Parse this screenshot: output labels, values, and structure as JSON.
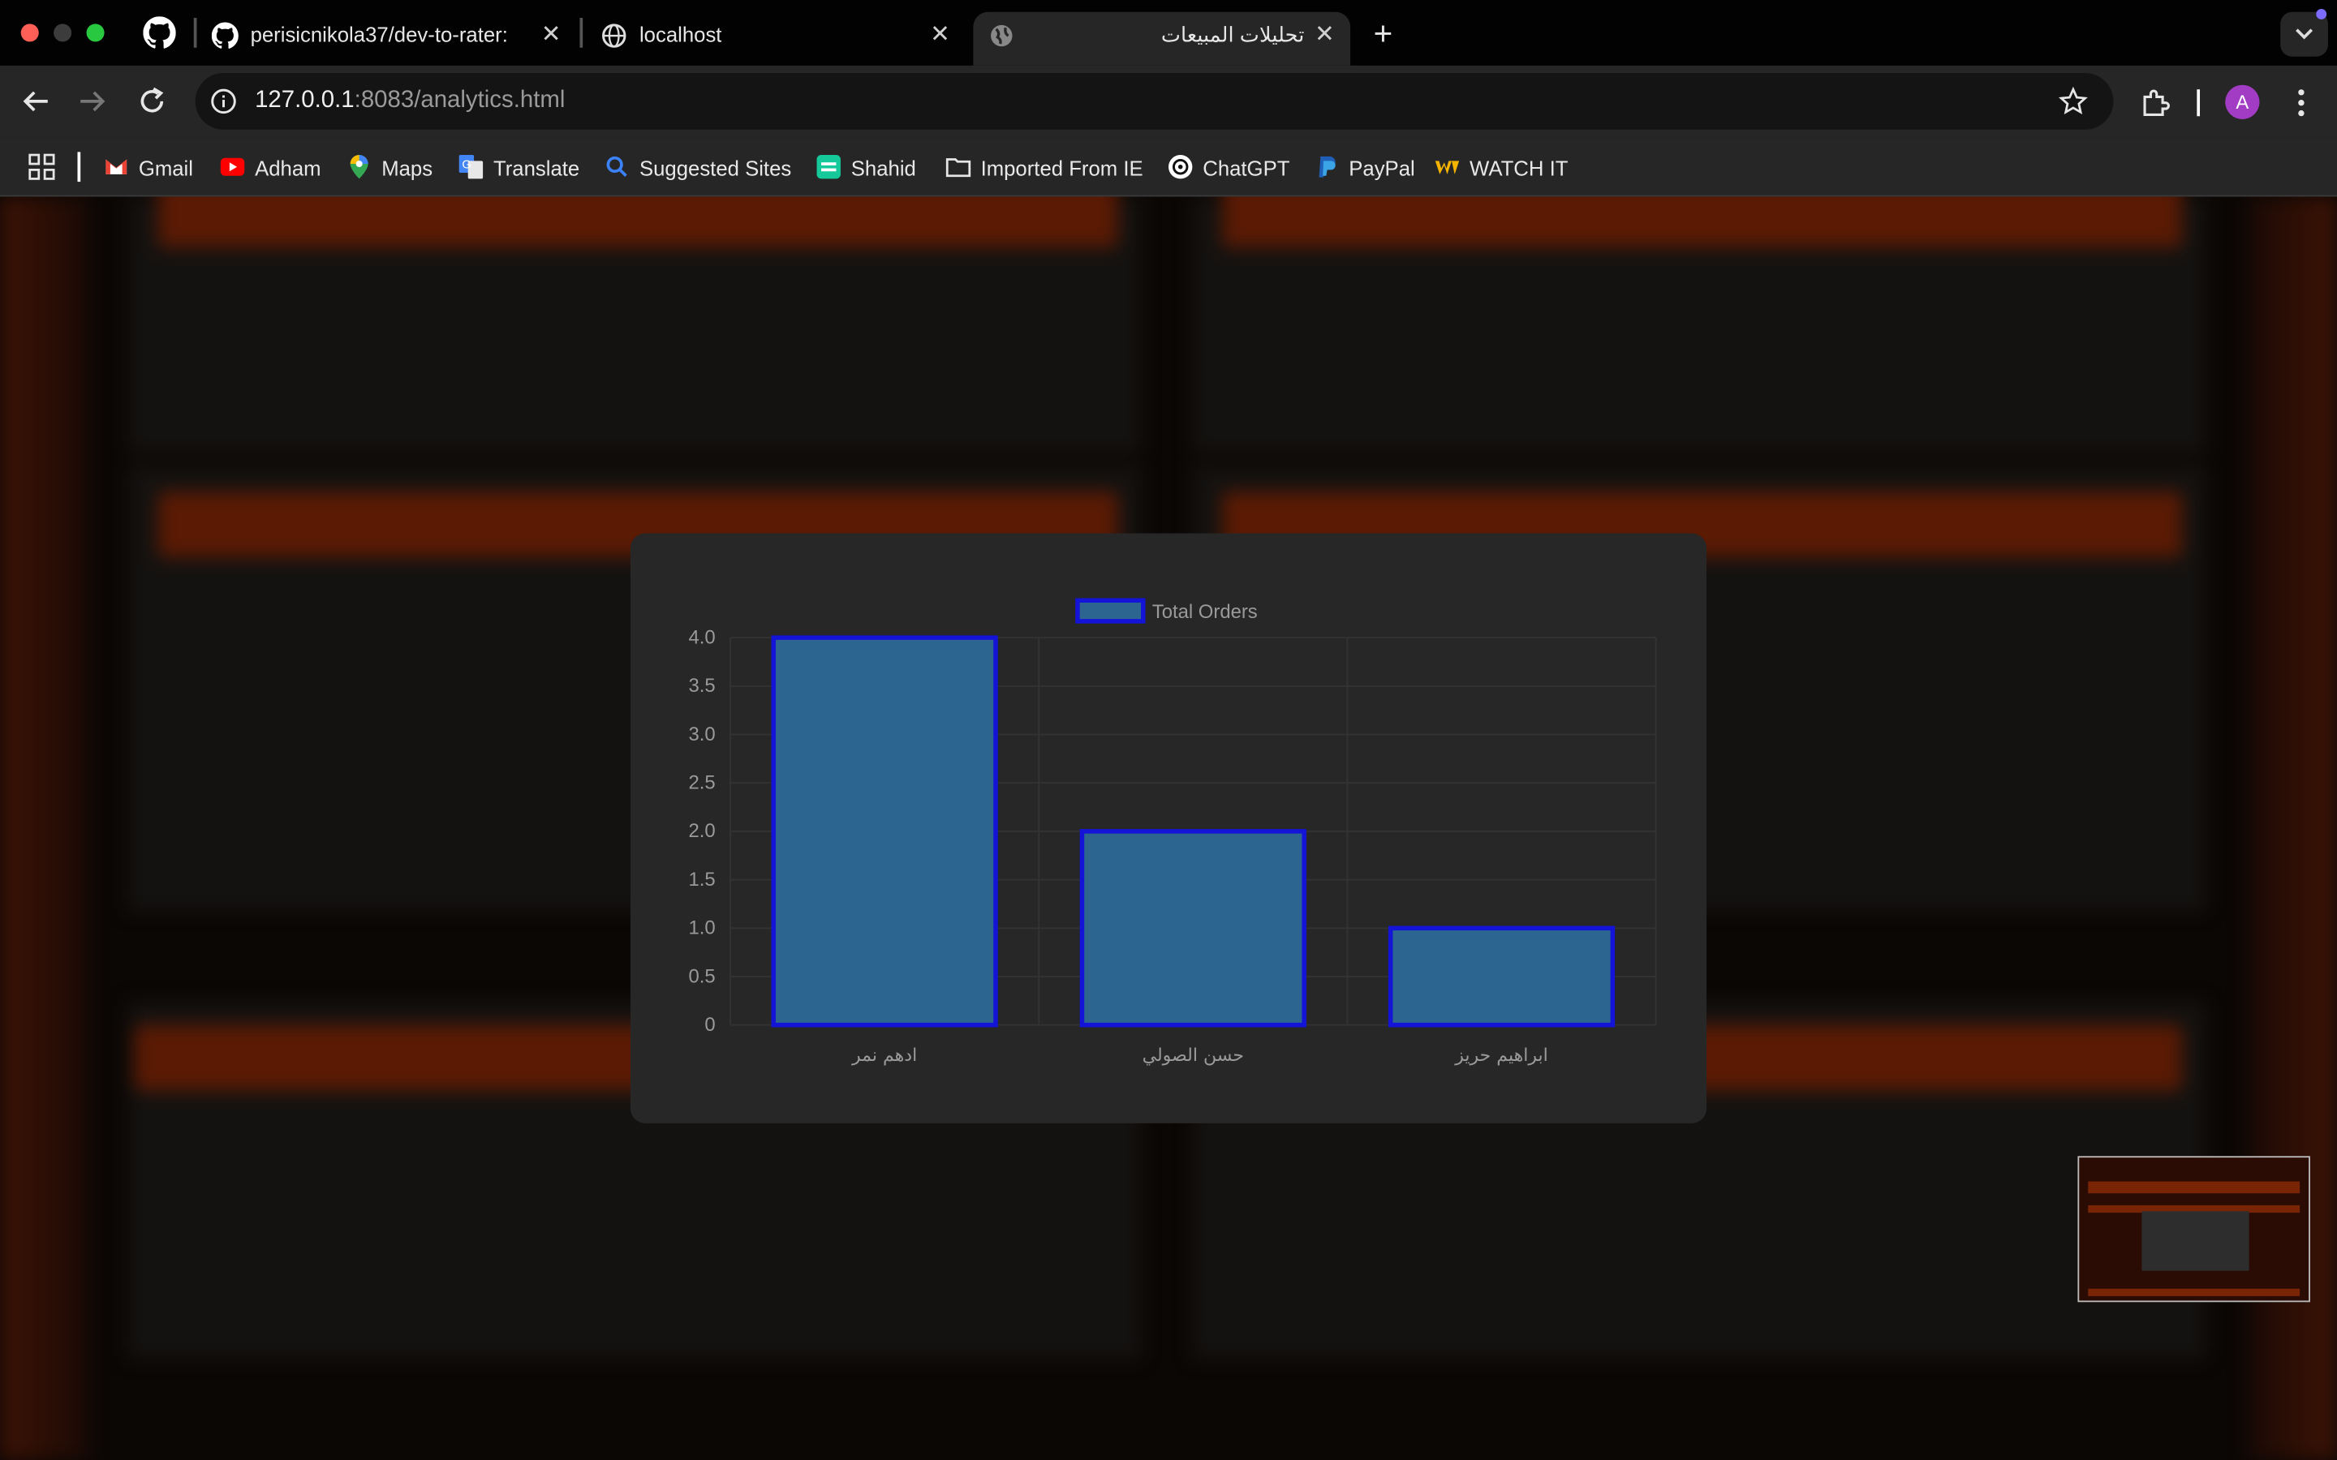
{
  "browser": {
    "tabs": [
      {
        "title": "perisicnikola37/dev-to-rater:",
        "close": "✕"
      },
      {
        "title": "localhost",
        "close": "✕"
      },
      {
        "title": "تحليلات المبيعات",
        "close": "✕"
      }
    ],
    "new_tab": "+",
    "url_host": "127.0.0.1",
    "url_rest": ":8083/analytics.html",
    "avatar_letter": "A"
  },
  "bookmarks": [
    {
      "label": "Gmail",
      "icon": "gmail-icon"
    },
    {
      "label": "Adham",
      "icon": "youtube-icon"
    },
    {
      "label": "Maps",
      "icon": "maps-icon"
    },
    {
      "label": "Translate",
      "icon": "translate-icon"
    },
    {
      "label": "Suggested Sites",
      "icon": "search-icon"
    },
    {
      "label": "Shahid",
      "icon": "shahid-icon"
    },
    {
      "label": "Imported From IE",
      "icon": "folder-icon"
    },
    {
      "label": "ChatGPT",
      "icon": "chatgpt-icon"
    },
    {
      "label": "PayPal",
      "icon": "paypal-icon"
    },
    {
      "label": "WATCH IT",
      "icon": "watchit-icon"
    }
  ],
  "chart_data": {
    "type": "bar",
    "categories": [
      "ادهم نمر",
      "حسن الصولي",
      "ابراهيم حريز"
    ],
    "series": [
      {
        "name": "Total Orders",
        "values": [
          4,
          2,
          1
        ]
      }
    ],
    "title": "",
    "xlabel": "",
    "ylabel": "",
    "ylim": [
      0,
      4
    ],
    "y_ticks": [
      "0",
      "0.5",
      "1.0",
      "1.5",
      "2.0",
      "2.5",
      "3.0",
      "3.5",
      "4.0"
    ],
    "legend_position": "top",
    "grid": true,
    "colors": {
      "bar_fill": "#2b6590",
      "bar_border": "#1414d8",
      "text": "#9a9a9a",
      "grid": "#333333"
    }
  }
}
